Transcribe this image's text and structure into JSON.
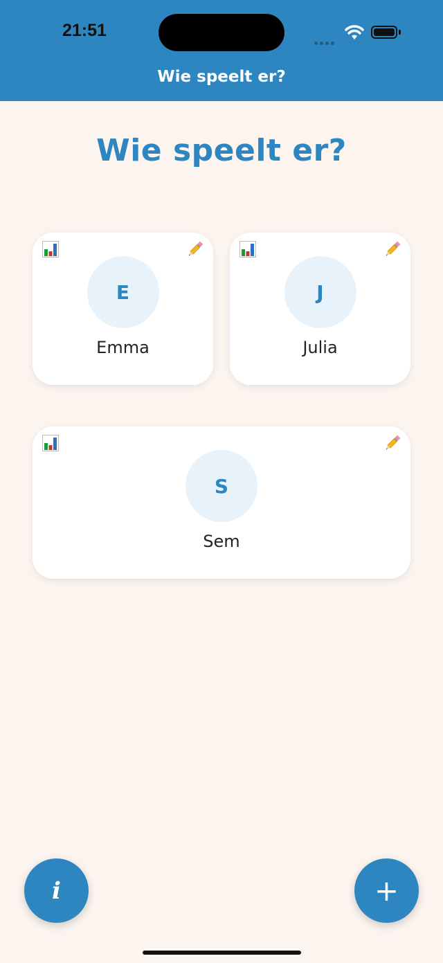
{
  "status_bar": {
    "time": "21:51"
  },
  "header": {
    "title": "Wie speelt er?"
  },
  "page": {
    "title": "Wie speelt er?"
  },
  "players": [
    {
      "initial": "E",
      "name": "Emma"
    },
    {
      "initial": "J",
      "name": "Julia"
    },
    {
      "initial": "S",
      "name": "Sem"
    }
  ],
  "icons": {
    "stats": "bar-chart-icon",
    "edit": "pencil-icon",
    "info": "info-icon",
    "add": "plus-icon"
  },
  "fab": {
    "info_label": "i",
    "add_label": "+"
  },
  "colors": {
    "primary": "#2e86c1",
    "background": "#fcf4ef",
    "avatar_bg": "#e8f2fa"
  }
}
